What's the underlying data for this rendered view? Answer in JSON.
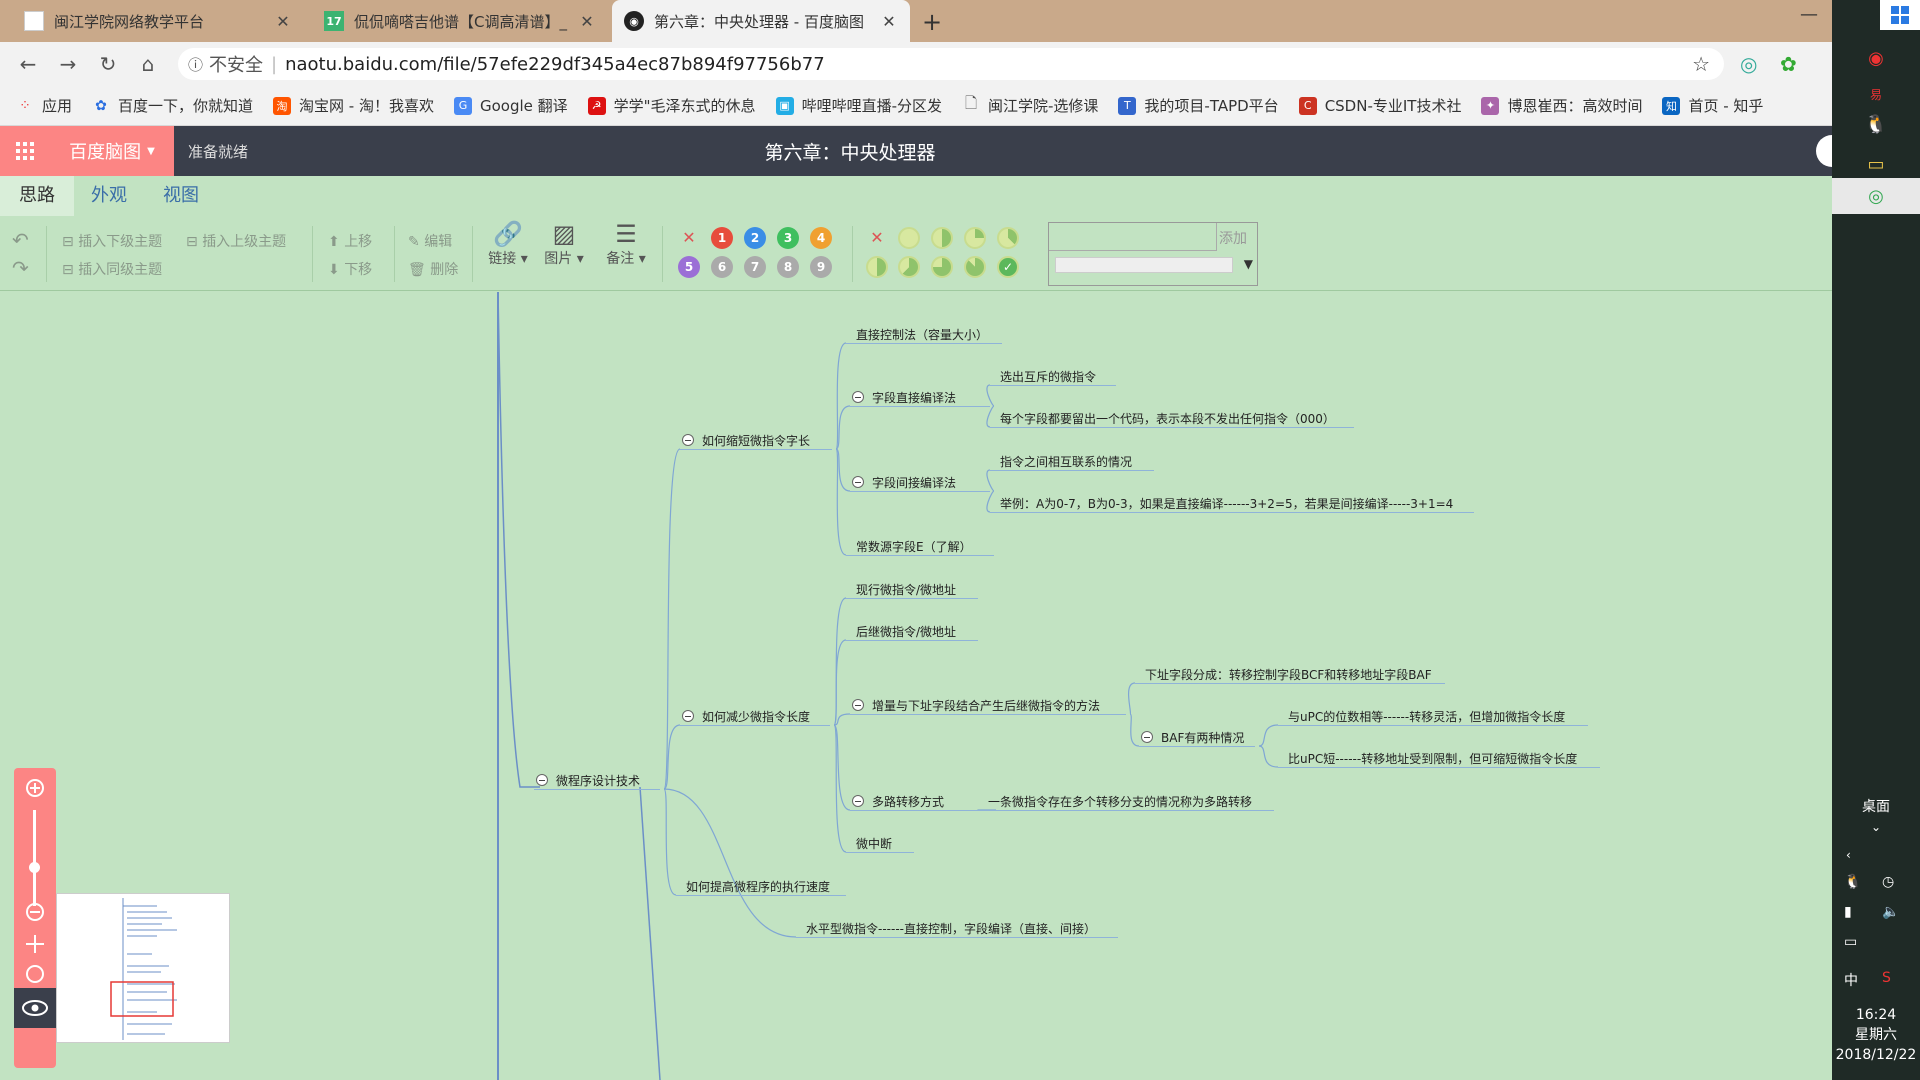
{
  "browser": {
    "tabs": [
      {
        "title": "闽江学院网络教学平台"
      },
      {
        "title": "侃侃嘀嗒吉他谱【C调高清谱】_"
      },
      {
        "title": "第六章：中央处理器 - 百度脑图"
      }
    ],
    "new_tab": "+",
    "address": {
      "security": "不安全",
      "url": "naotu.baidu.com/file/57efe229df345a4ec87b894f97756b77"
    },
    "bookmarks": [
      {
        "label": "应用"
      },
      {
        "label": "百度一下，你就知道"
      },
      {
        "label": "淘宝网 - 淘！我喜欢"
      },
      {
        "label": "Google 翻译"
      },
      {
        "label": "学学\"毛泽东式的休息"
      },
      {
        "label": "哔哩哔哩直播-分区发"
      },
      {
        "label": "闽江学院-选修课"
      },
      {
        "label": "我的项目-TAPD平台"
      },
      {
        "label": "CSDN-专业IT技术社"
      },
      {
        "label": "博恩崔西：高效时间"
      },
      {
        "label": "首页 - 知乎"
      }
    ]
  },
  "app": {
    "brand": "百度脑图",
    "status": "准备就绪",
    "title": "第六章：中央处理器",
    "menu_tabs": [
      {
        "label": "思路"
      },
      {
        "label": "外观"
      },
      {
        "label": "视图"
      }
    ],
    "toolbar": {
      "insert_child": "插入下级主题",
      "insert_parent": "插入上级主题",
      "insert_sibling": "插入同级主题",
      "move_up": "上移",
      "move_down": "下移",
      "edit": "编辑",
      "delete": "删除",
      "link": "链接",
      "image": "图片",
      "note": "备注",
      "add_tag": "添加",
      "priorities": [
        "1",
        "2",
        "3",
        "4",
        "5",
        "6",
        "7",
        "8",
        "9"
      ],
      "priority_colors": [
        "#e74c3c",
        "#3a8ee6",
        "#3fbf5f",
        "#f0a030",
        "#9b6fd6",
        "#aaaaaa",
        "#aaaaaa",
        "#aaaaaa",
        "#aaaaaa"
      ]
    }
  },
  "mindmap": {
    "nodes": [
      {
        "text": "直接控制法（容量大小）"
      },
      {
        "text": "字段直接编译法"
      },
      {
        "text": "选出互斥的微指令"
      },
      {
        "text": "每个字段都要留出一个代码，表示本段不发出任何指令（000）"
      },
      {
        "text": "如何缩短微指令字长"
      },
      {
        "text": "指令之间相互联系的情况"
      },
      {
        "text": "字段间接编译法"
      },
      {
        "text": "举例：A为0-7，B为0-3，如果是直接编译------3+2=5，若果是间接编译-----3+1=4"
      },
      {
        "text": "常数源字段E（了解）"
      },
      {
        "text": "现行微指令/微地址"
      },
      {
        "text": "后继微指令/微地址"
      },
      {
        "text": "下址字段分成：转移控制字段BCF和转移地址字段BAF"
      },
      {
        "text": "增量与下址字段结合产生后继微指令的方法"
      },
      {
        "text": "如何减少微指令长度"
      },
      {
        "text": "与uPC的位数相等------转移灵活，但增加微指令长度"
      },
      {
        "text": "BAF有两种情况"
      },
      {
        "text": "比uPC短------转移地址受到限制，但可缩短微指令长度"
      },
      {
        "text": "微程序设计技术"
      },
      {
        "text": "多路转移方式"
      },
      {
        "text": "一条微指令存在多个转移分支的情况称为多路转移"
      },
      {
        "text": "微中断"
      },
      {
        "text": "如何提高微程序的执行速度"
      },
      {
        "text": "水平型微指令------直接控制，字段编译（直接、间接）"
      }
    ]
  },
  "taskbar": {
    "desktop": "桌面",
    "time": "16:24",
    "weekday": "星期六",
    "date": "2018/12/22",
    "ime": "中"
  }
}
